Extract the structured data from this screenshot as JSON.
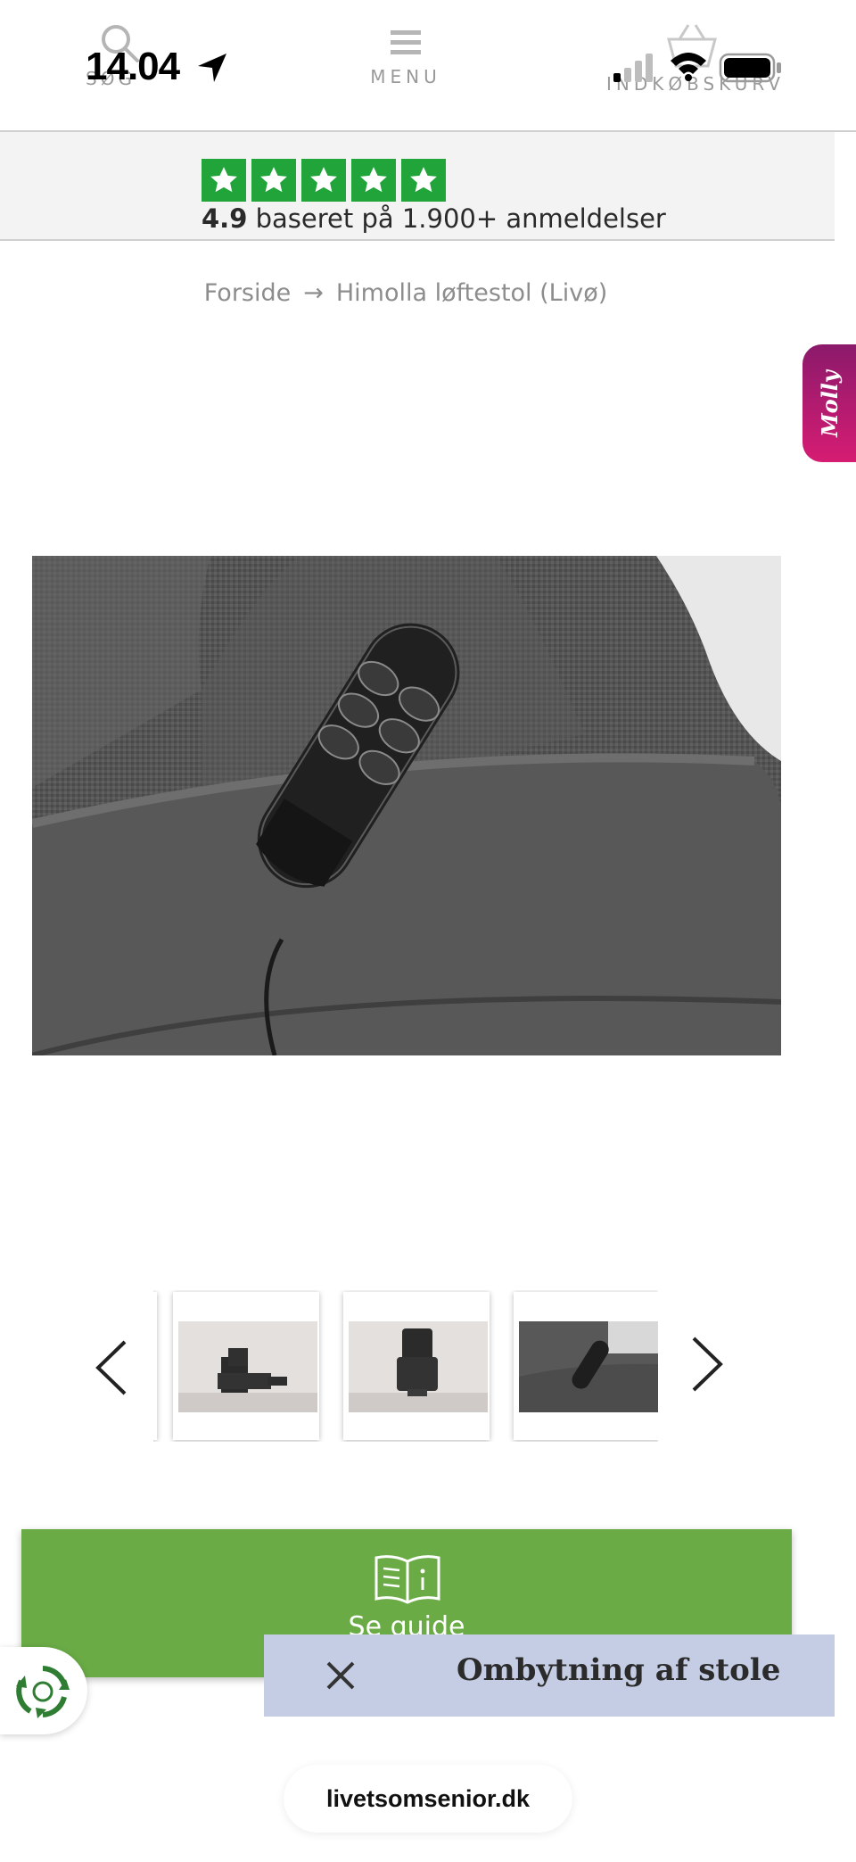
{
  "status_bar": {
    "time": "14.04"
  },
  "header": {
    "search_label": "SØG",
    "menu_label": "MENU",
    "cart_label": "INDKØBSKURV"
  },
  "rating": {
    "stars": 5,
    "score": "4.9",
    "text": "baseret på 1.900+ anmeldelser",
    "star_color": "#21a53a"
  },
  "breadcrumb": {
    "home": "Forside",
    "separator": "→",
    "current": "Himolla løftestol (Livø)"
  },
  "chat_tab": {
    "label": "Molly"
  },
  "gallery": {
    "main_image": "remote-control-on-grey-armchair",
    "thumbnails": [
      {
        "name": "recliner-reclined"
      },
      {
        "name": "recliner-upright"
      },
      {
        "name": "remote-control-closeup"
      }
    ]
  },
  "guide_button": {
    "label": "Se guide",
    "color": "#6aab46"
  },
  "swap_banner": {
    "text": "Ombytning af stole",
    "color": "#c4cde4"
  },
  "browser": {
    "url": "livetsomsenior.dk"
  }
}
